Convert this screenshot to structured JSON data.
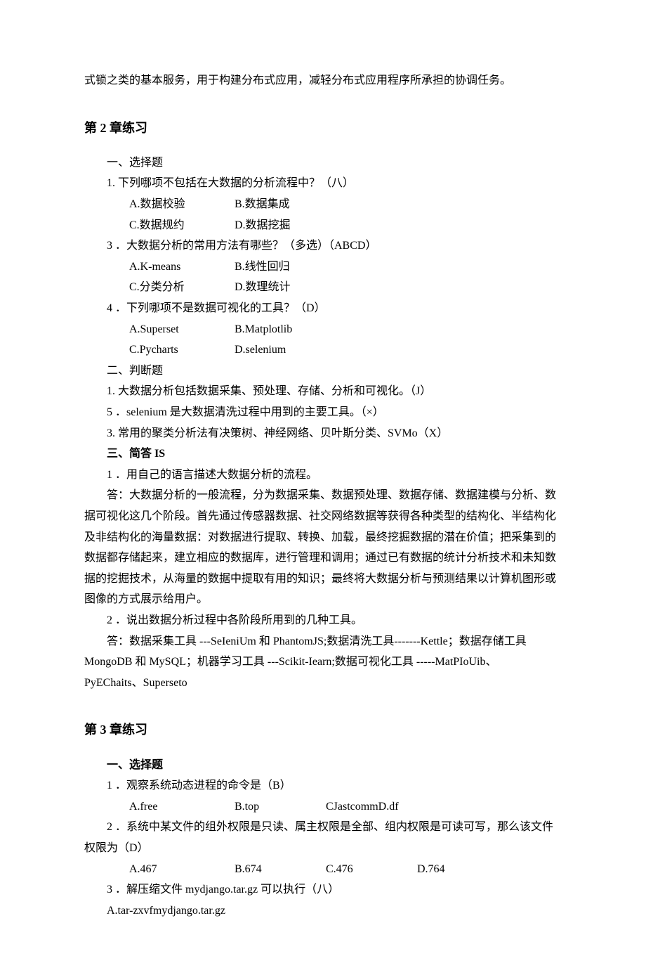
{
  "intro_tail": "式锁之类的基本服务，用于构建分布式应用，减轻分布式应用程序所承担的协调任务。",
  "ch2": {
    "heading": "第 2 章练习",
    "sec1_title": "一、选择题",
    "q1": "1. 下列哪项不包括在大数据的分析流程中？（八）",
    "q1a": "A.数据校验",
    "q1b": "B.数据集成",
    "q1c": "C.数据规约",
    "q1d": "D.数据挖掘",
    "q3": "3 ．大数据分析的常用方法有哪些？（多选）（ABCD）",
    "q3a": "A.K-means",
    "q3b": "B.线性回归",
    "q3c": "C.分类分析",
    "q3d": "D.数理统计",
    "q4": "4 ．下列哪项不是数据可视化的工具？（D）",
    "q4a": "A.Superset",
    "q4b": "B.Matplotlib",
    "q4c": "C.Pycharts",
    "q4d": "D.selenium",
    "sec2_title": "二、判断题",
    "tf1": "1. 大数据分析包括数据采集、预处理、存储、分析和可视化。（J）",
    "tf5": "5 ．selenium 是大数据清洗过程中用到的主要工具。（×）",
    "tf3": "3. 常用的聚类分析法有决策树、神经网络、贝叶斯分类、SVMo（X）",
    "sec3_title": "三、简答 IS",
    "sa1q": "1 ．用自己的语言描述大数据分析的流程。",
    "sa1a_l1": "答：大数据分析的一般流程，分为数据采集、数据预处理、数据存储、数据建模与分析、数",
    "sa1a_l2": "据可视化这几个阶段。首先通过传感器数据、社交网络数据等获得各种类型的结构化、半结构化",
    "sa1a_l3": "及非结构化的海量数据：对数据进行提取、转换、加载，最终挖掘数据的潜在价值；把采集到的",
    "sa1a_l4": "数据都存储起来，建立相应的数据库，进行管理和调用；通过已有数据的统计分析技术和未知数",
    "sa1a_l5": "据的挖掘技术，从海量的数据中提取有用的知识；最终将大数据分析与预测结果以计算机图形或",
    "sa1a_l6": "图像的方式展示给用户。",
    "sa2q": "2 ．说出数据分析过程中各阶段所用到的几种工具。",
    "sa2a_l1": "答：数据采集工具 ---SeIeniUm 和 PhantomJS;数据清洗工具-------Kettle；数据存储工具",
    "sa2a_l2": "MongoDB 和 MySQL；机器学习工具 ---Scikit-Iearn;数据可视化工具 -----MatPIoUib、",
    "sa2a_l3": "PyEChaits、Superseto"
  },
  "ch3": {
    "heading": "第 3 章练习",
    "sec1_title": "一、选择题",
    "q1": "1 ．观察系统动态进程的命令是（B）",
    "q1a": "A.free",
    "q1b": "B.top",
    "q1c": "CJastcommD.df",
    "q2_l1": "2 ．系统中某文件的组外权限是只读、属主权限是全部、组内权限是可读可写，那么该文件",
    "q2_l2": "权限为（D）",
    "q2a": "A.467",
    "q2b": "B.674",
    "q2c": "C.476",
    "q2d": "D.764",
    "q3": "3 ．解压缩文件 mydjango.tar.gz 可以执行（八）",
    "q3a": "A.tar-zxvfmydjango.tar.gz"
  }
}
